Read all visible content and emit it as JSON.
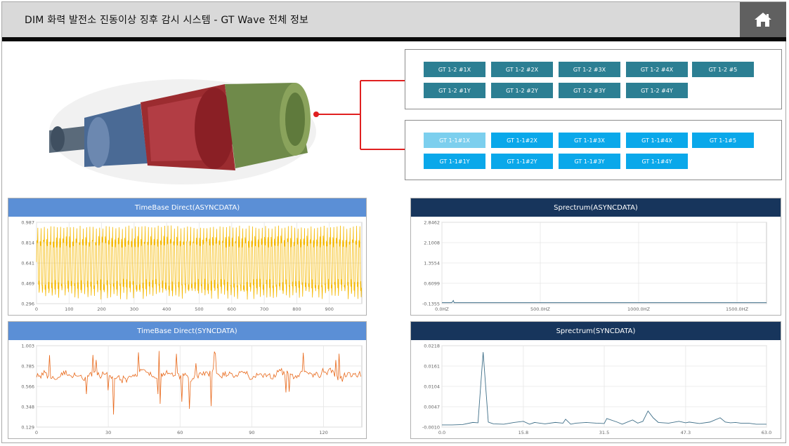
{
  "header": {
    "title": "DIM  화력 발전소 진동이상 징후 감시 시스템 - GT Wave 전체 정보"
  },
  "icons": {
    "home": "home-icon"
  },
  "colors": {
    "teal": "#2c7f93",
    "cyan": "#0aa8ea",
    "cyan_selected": "#7ccfee",
    "blue_title": "#5b8fd6",
    "navy_title": "#17355c",
    "yellow_wave": "#f5b800",
    "orange_wave": "#e8681a",
    "spectrum_line": "#3f6f88",
    "connector": "#e02020"
  },
  "sensors_gt12": [
    [
      "GT 1-2 #1X",
      "GT 1-2 #2X",
      "GT 1-2 #3X",
      "GT 1-2 #4X",
      "GT 1-2 #5"
    ],
    [
      "GT 1-2 #1Y",
      "GT 1-2 #2Y",
      "GT 1-2 #3Y",
      "GT 1-2 #4Y"
    ]
  ],
  "sensors_gt11": [
    [
      "GT 1-1#1X",
      "GT 1-1#2X",
      "GT 1-1#3X",
      "GT 1-1#4X",
      "GT 1-1#5"
    ],
    [
      "GT 1-1#1Y",
      "GT 1-1#2Y",
      "GT 1-1#3Y",
      "GT 1-1#4Y"
    ]
  ],
  "selected_sensor": "GT 1-1#1X",
  "panels": {
    "tb_async": {
      "title": "TimeBase Direct(ASYNCDATA)"
    },
    "tb_sync": {
      "title": "TimeBase Direct(SYNCDATA)"
    },
    "sp_async": {
      "title": "Sprectrum(ASYNCDATA)"
    },
    "sp_sync": {
      "title": "Sprectrum(SYNCDATA)"
    }
  },
  "chart_data": [
    {
      "id": "tb_async",
      "type": "line",
      "title": "TimeBase Direct(ASYNCDATA)",
      "xlim": [
        0,
        1000
      ],
      "ylim": [
        0.296,
        0.987
      ],
      "xticks": [
        "0",
        "100",
        "200",
        "300",
        "400",
        "500",
        "600",
        "700",
        "800",
        "900"
      ],
      "xtick_values": [
        0,
        100,
        200,
        300,
        400,
        500,
        600,
        700,
        800,
        900
      ],
      "yticks": [
        "0.987",
        "0.814",
        "0.641",
        "0.469",
        "0.296"
      ],
      "ytick_values": [
        0.987,
        0.814,
        0.641,
        0.469,
        0.296
      ],
      "series": [
        {
          "pattern": "periodic oscillation",
          "mean": 0.64,
          "amplitude": 0.3,
          "cycles": 100,
          "points": 1000,
          "range": [
            0.33,
            0.96
          ]
        }
      ]
    },
    {
      "id": "tb_sync",
      "type": "line",
      "title": "TimeBase Direct(SYNCDATA)",
      "xlim": [
        0,
        136
      ],
      "ylim": [
        0.129,
        1.003
      ],
      "xticks": [
        "0",
        "30",
        "60",
        "90",
        "120"
      ],
      "xtick_values": [
        0,
        30,
        60,
        90,
        120
      ],
      "yticks": [
        "1.003",
        "0.785",
        "0.566",
        "0.348",
        "0.129"
      ],
      "ytick_values": [
        1.003,
        0.785,
        0.566,
        0.348,
        0.129
      ],
      "series": [
        {
          "pattern": "noisy signal with spikes",
          "mean": 0.68,
          "points": 300,
          "range": [
            0.2,
            0.98
          ]
        }
      ]
    },
    {
      "id": "sp_async",
      "type": "line",
      "title": "Sprectrum(ASYNCDATA)",
      "xlim": [
        0,
        1650
      ],
      "ylim": [
        -0.1355,
        2.8462
      ],
      "xticks": [
        "0.0HZ",
        "500.0HZ",
        "1000.0HZ",
        "1500.0HZ"
      ],
      "xtick_values": [
        0,
        500,
        1000,
        1500
      ],
      "yticks": [
        "2.8462",
        "2.1008",
        "1.3554",
        "0.6099",
        "-0.1355"
      ],
      "ytick_values": [
        2.8462,
        2.1008,
        1.3554,
        0.6099,
        -0.1355
      ],
      "series": [
        {
          "peak": [
            60,
            0.04
          ],
          "baseline": -0.1,
          "points": [
            [
              0,
              -0.1
            ],
            [
              50,
              -0.1
            ],
            [
              58,
              -0.02
            ],
            [
              62,
              -0.1
            ],
            [
              1650,
              -0.1
            ]
          ]
        }
      ]
    },
    {
      "id": "sp_sync",
      "type": "line",
      "title": "Sprectrum(SYNCDATA)",
      "xlim": [
        0,
        63.0
      ],
      "ylim": [
        -0.001,
        0.0218
      ],
      "xticks": [
        "0.0",
        "15.8",
        "31.5",
        "47.3",
        "63.0"
      ],
      "xtick_values": [
        0,
        15.8,
        31.5,
        47.3,
        63.0
      ],
      "yticks": [
        "0.0218",
        "0.0161",
        "0.0104",
        "0.0047",
        "-0.0010"
      ],
      "ytick_values": [
        0.0218,
        0.0161,
        0.0104,
        0.0047,
        -0.001
      ],
      "series": [
        {
          "points": [
            [
              0,
              -0.0004
            ],
            [
              2,
              -0.0004
            ],
            [
              4,
              -0.0003
            ],
            [
              6,
              0.0003
            ],
            [
              7,
              0.0002
            ],
            [
              8,
              0.02
            ],
            [
              9,
              0.0004
            ],
            [
              10,
              -0.0001
            ],
            [
              12,
              -0.0002
            ],
            [
              14,
              0.0003
            ],
            [
              15.8,
              0.0006
            ],
            [
              17,
              -0.0002
            ],
            [
              18,
              0.0003
            ],
            [
              20,
              -0.0001
            ],
            [
              22,
              0.0003
            ],
            [
              23.5,
              0.0001
            ],
            [
              24,
              0.0012
            ],
            [
              25,
              -0.0002
            ],
            [
              26,
              0.0001
            ],
            [
              28,
              0.0003
            ],
            [
              30,
              0.0001
            ],
            [
              31.5,
              0.0
            ],
            [
              32,
              0.0014
            ],
            [
              34,
              0.0004
            ],
            [
              35,
              -0.0002
            ],
            [
              37,
              0.001
            ],
            [
              38,
              0.0001
            ],
            [
              39,
              0.0006
            ],
            [
              40,
              0.0035
            ],
            [
              41,
              0.0016
            ],
            [
              42,
              0.0003
            ],
            [
              44,
              0.0001
            ],
            [
              46,
              0.0006
            ],
            [
              47.3,
              0.0002
            ],
            [
              48,
              0.0004
            ],
            [
              50,
              0.0
            ],
            [
              52,
              0.0004
            ],
            [
              54,
              0.0016
            ],
            [
              55,
              0.0004
            ],
            [
              56,
              0.0002
            ],
            [
              57,
              0.0003
            ],
            [
              58,
              0.0001
            ],
            [
              59.5,
              0.0001
            ],
            [
              61,
              -0.0002
            ],
            [
              63,
              -0.0002
            ]
          ]
        }
      ]
    }
  ]
}
